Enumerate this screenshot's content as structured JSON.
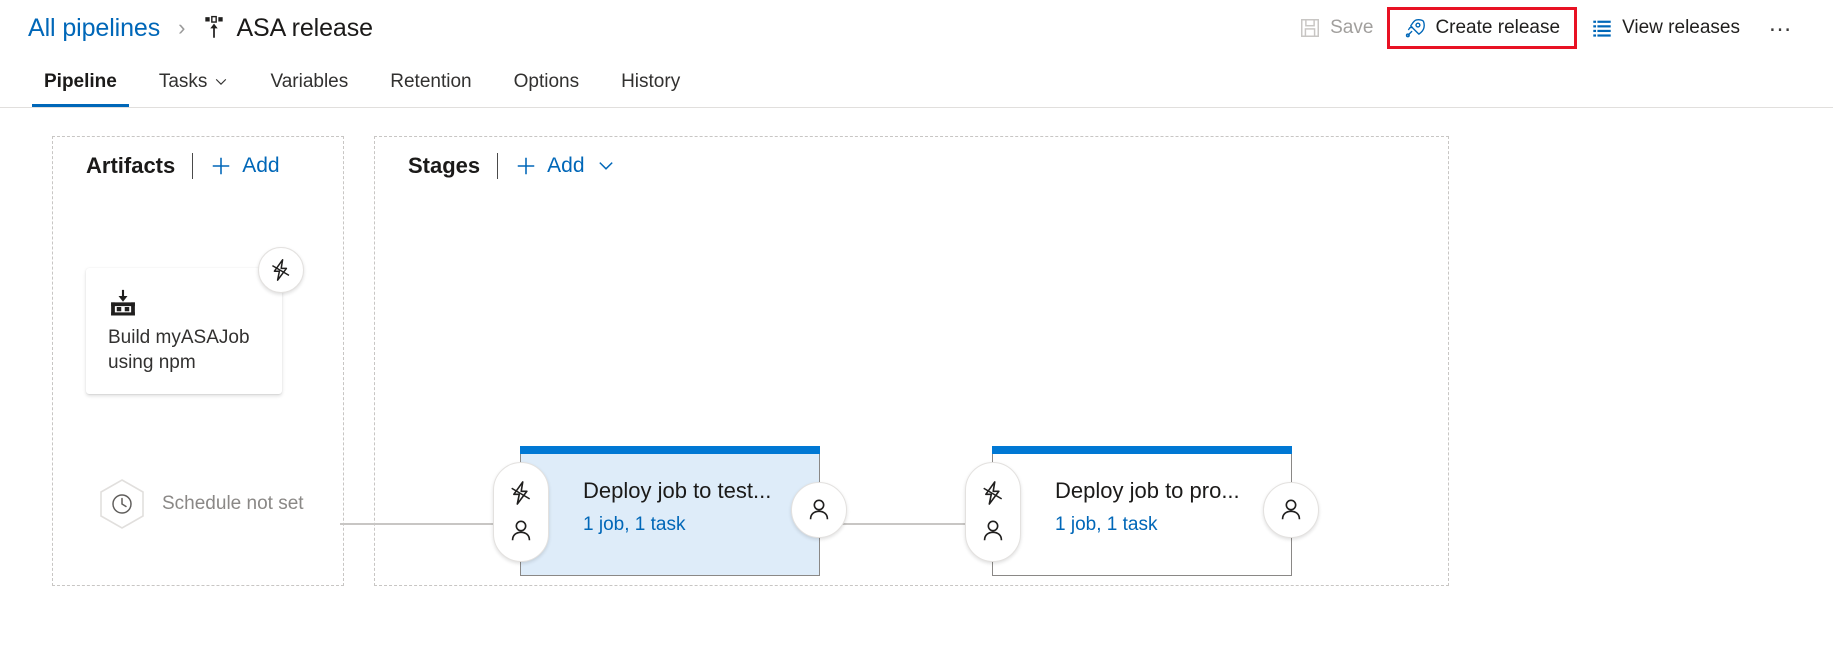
{
  "breadcrumb": {
    "root_label": "All pipelines",
    "separator": "›",
    "pipeline_icon": "release-pipeline-icon",
    "current_label": "ASA release"
  },
  "toolbar": {
    "save": {
      "label": "Save",
      "icon": "save-floppy-icon",
      "disabled": true
    },
    "create_release": {
      "label": "Create release",
      "icon": "rocket-icon",
      "highlight_color": "#e81123"
    },
    "view_releases": {
      "label": "View releases",
      "icon": "list-icon"
    },
    "more": {
      "label": "…",
      "icon": "ellipsis-icon"
    }
  },
  "tabs": [
    {
      "label": "Pipeline",
      "active": true,
      "has_chevron": false
    },
    {
      "label": "Tasks",
      "active": false,
      "has_chevron": true
    },
    {
      "label": "Variables",
      "active": false,
      "has_chevron": false
    },
    {
      "label": "Retention",
      "active": false,
      "has_chevron": false
    },
    {
      "label": "Options",
      "active": false,
      "has_chevron": false
    },
    {
      "label": "History",
      "active": false,
      "has_chevron": false
    }
  ],
  "artifacts_panel": {
    "title": "Artifacts",
    "add_label": "Add",
    "artifact": {
      "name": "Build myASAJob using npm",
      "icon": "build-artifact-icon",
      "trigger_icon": "lightning-bolt-icon"
    },
    "schedule": {
      "label": "Schedule not set",
      "icon": "clock-icon"
    }
  },
  "stages_panel": {
    "title": "Stages",
    "add_label": "Add",
    "stages": [
      {
        "name": "Deploy job to test...",
        "meta": "1 job, 1 task",
        "selected": true,
        "pre_deployment_icons": [
          "lightning-bolt-icon",
          "person-icon"
        ],
        "post_deployment_icon": "person-icon"
      },
      {
        "name": "Deploy job to pro...",
        "meta": "1 job, 1 task",
        "selected": false,
        "pre_deployment_icons": [
          "lightning-bolt-icon",
          "person-icon"
        ],
        "post_deployment_icon": "person-icon"
      }
    ]
  },
  "colors": {
    "link_blue": "#0067b8",
    "accent_blue": "#0078d4",
    "selected_stage_fill": "#deecf9",
    "highlight_red": "#e81123",
    "muted_gray": "#a19f9d"
  }
}
